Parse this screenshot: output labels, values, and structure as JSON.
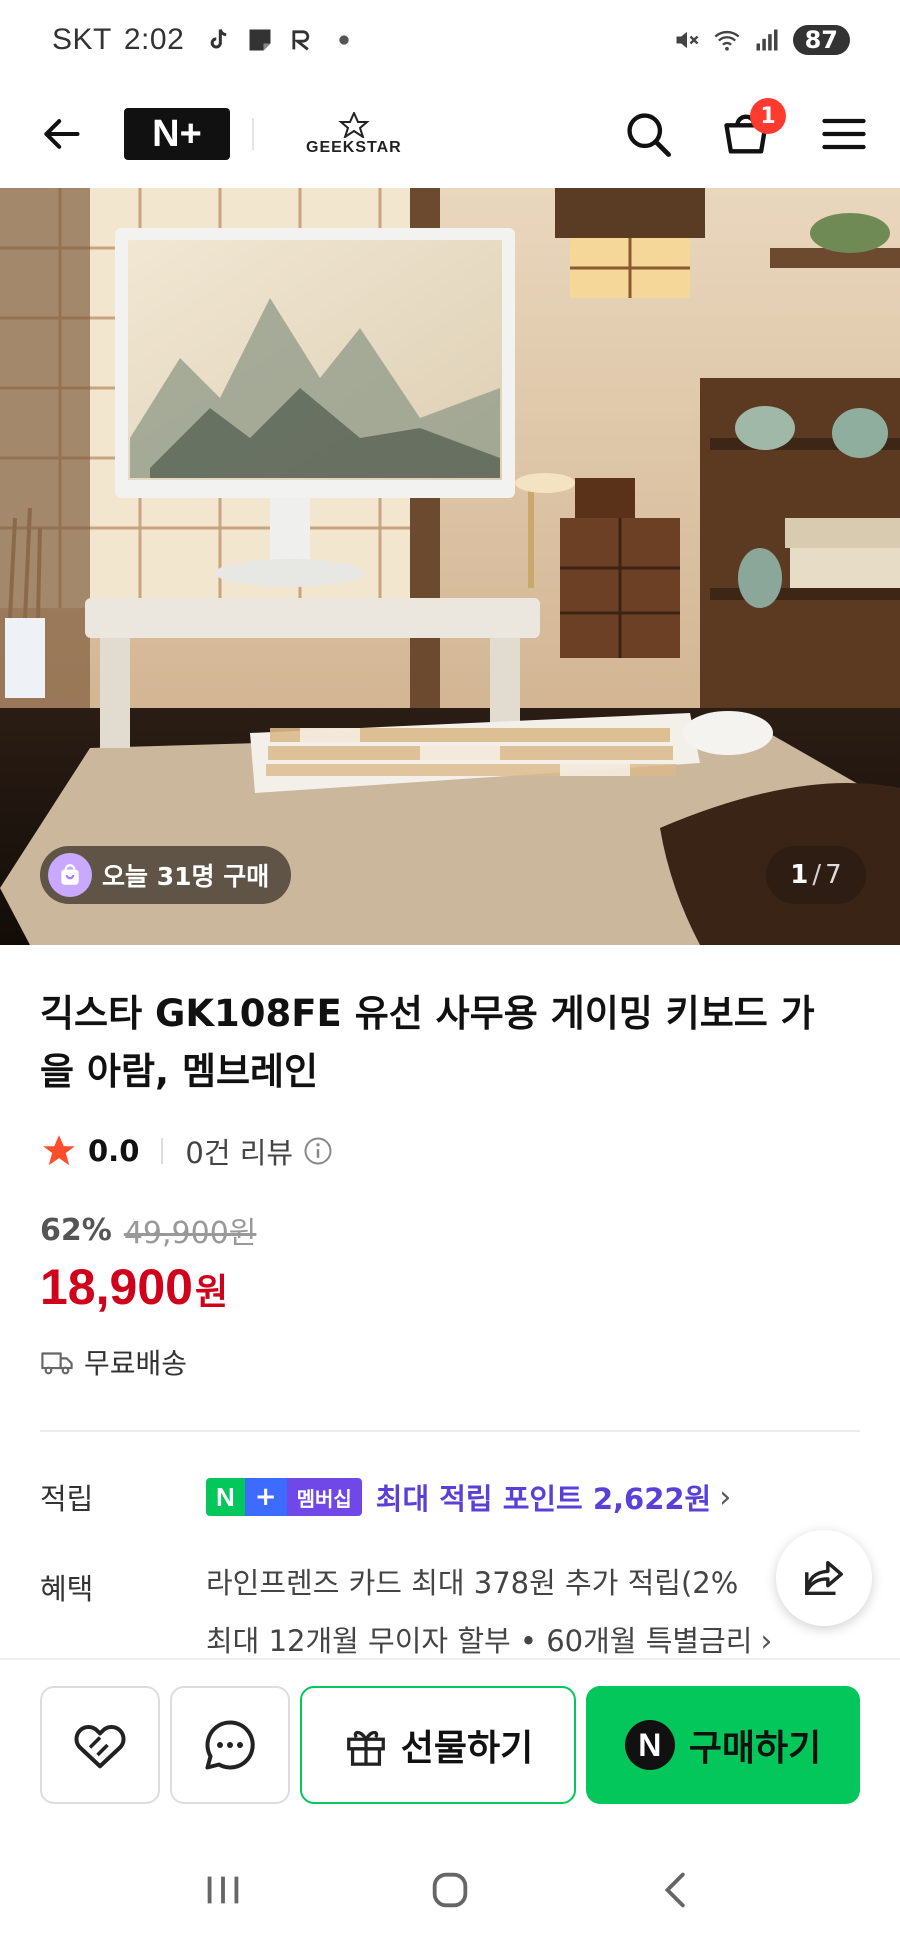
{
  "status_bar": {
    "carrier": "SKT",
    "time": "2:02",
    "battery": "87"
  },
  "header": {
    "nplus_label": "N+",
    "brand_name": "GEEKSTAR",
    "cart_count": "1"
  },
  "hero": {
    "buyers_today": "오늘 31명 구매",
    "current_page": "1",
    "page_sep": "/",
    "total_pages": "7"
  },
  "product": {
    "title": "긱스타 GK108FE 유선 사무용 게이밍 키보드 가을 아람, 멤브레인",
    "rating": "0.0",
    "review_count": "0건 리뷰",
    "discount_rate": "62%",
    "original_price": "49,900원",
    "price": "18,900",
    "price_unit": "원",
    "shipping": "무료배송"
  },
  "benefits": {
    "points_label": "적립",
    "membership_badge_n": "N",
    "membership_badge_plus": "+",
    "membership_badge_text": "멤버십",
    "points_text": "최대 적립 포인트 2,622원",
    "benefit_label": "혜택",
    "benefit_line1": "라인프렌즈 카드 최대 378원 추가 적립(2%",
    "benefit_line2": "최대 12개월 무이자 할부 • 60개월 특별금리"
  },
  "actions": {
    "gift_label": "선물하기",
    "buy_label": "구매하기",
    "buy_badge": "N"
  },
  "colors": {
    "naver_green": "#03c75a",
    "price_red": "#d0021b",
    "points_purple": "#5b3fd9",
    "badge_red": "#ff3b30"
  },
  "icons": {
    "back": "back-arrow-icon",
    "search": "search-icon",
    "cart": "cart-icon",
    "menu": "hamburger-menu-icon",
    "star": "star-icon",
    "info": "info-icon",
    "truck": "truck-icon",
    "share": "share-icon",
    "like": "heart-icon",
    "chat": "chat-bubble-icon",
    "gift": "gift-icon"
  }
}
